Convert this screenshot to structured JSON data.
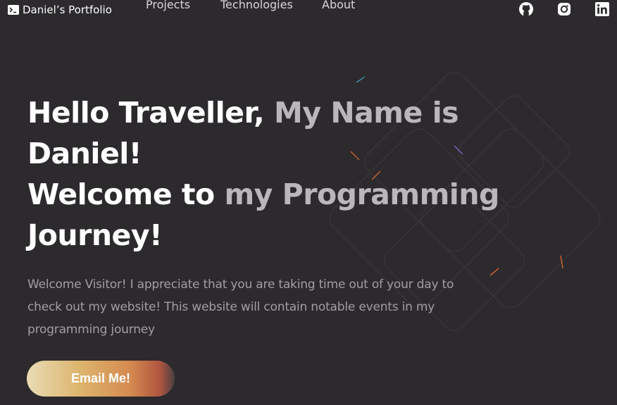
{
  "nav": {
    "brand": "Daniel’s Portfolio",
    "links": [
      {
        "label": "Projects"
      },
      {
        "label": "Technologies"
      },
      {
        "label": "About"
      }
    ],
    "social_icons": [
      "github-icon",
      "instagram-icon",
      "linkedin-icon"
    ]
  },
  "hero": {
    "title_lines": [
      {
        "white": "Hello Traveller, ",
        "gray": "My Name is"
      },
      {
        "white": "Daniel!",
        "gray": ""
      },
      {
        "white": "Welcome to ",
        "gray": "my Programming"
      },
      {
        "white": "Journey!",
        "gray": ""
      }
    ],
    "intro": "Welcome Visitor! I appreciate that you are taking time out of your day to check out my website! This website will contain notable events in my programming journey",
    "cta_label": "Email Me!"
  },
  "colors": {
    "background": "#2c2a2d",
    "title_white": "#ffffff",
    "title_gray": "#b9b7ba",
    "intro_text": "#a29fa3",
    "button_gradient": [
      "#e9dcb6",
      "#ddb66e",
      "#d58a50",
      "#b0553f",
      "#4a3f40"
    ]
  }
}
